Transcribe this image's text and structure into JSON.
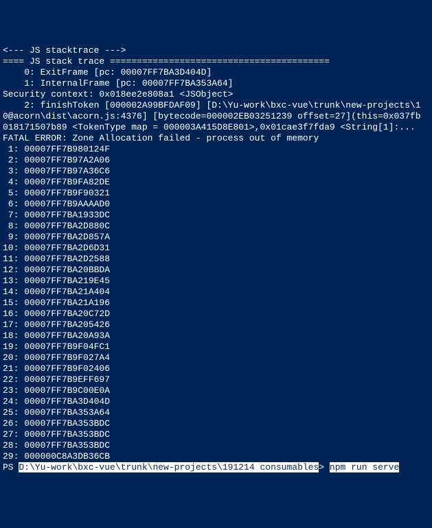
{
  "lines": [
    "<--- JS stacktrace --->",
    "",
    "==== JS stack trace =========================================",
    "",
    "    0: ExitFrame [pc: 00007FF7BA3D404D]",
    "    1: InternalFrame [pc: 00007FF7BA353A64]",
    "Security context: 0x018ee2e808a1 <JSObject>",
    "    2: finishToken [000002A99BFDAF09] [D:\\Yu-work\\bxc-vue\\trunk\\new-projects\\1",
    "0@acorn\\dist\\acorn.js:4376] [bytecode=000002EB03251239 offset=27](this=0x037fb",
    "018171507b89 <TokenType map = 000003A415D8E801>,0x01cae3f7fda9 <String[1]:...",
    "",
    "FATAL ERROR: Zone Allocation failed - process out of memory",
    " 1: 00007FF7B980124F",
    " 2: 00007FF7B97A2A06",
    " 3: 00007FF7B97A36C6",
    " 4: 00007FF7B9FA82DE",
    " 5: 00007FF7B9F90321",
    " 6: 00007FF7B9AAAAD0",
    " 7: 00007FF7BA1933DC",
    " 8: 00007FF7BA2D880C",
    " 9: 00007FF7BA2D857A",
    "10: 00007FF7BA2D6D31",
    "11: 00007FF7BA2D2588",
    "12: 00007FF7BA20BBDA",
    "13: 00007FF7BA219E45",
    "14: 00007FF7BA21A404",
    "15: 00007FF7BA21A196",
    "16: 00007FF7BA20C72D",
    "17: 00007FF7BA205426",
    "18: 00007FF7BA20A93A",
    "19: 00007FF7B9F04FC1",
    "20: 00007FF7B9F027A4",
    "21: 00007FF7B9F02406",
    "22: 00007FF7B9EFF697",
    "23: 00007FF7B9C00E0A",
    "24: 00007FF7BA3D404D",
    "25: 00007FF7BA353A64",
    "26: 00007FF7BA353BDC",
    "27: 00007FF7BA353BDC",
    "28: 00007FF7BA353BDC",
    "29: 000000C8A3DB36CB"
  ],
  "prompt_prefix": "PS ",
  "prompt_path": "D:\\Yu-work\\bxc-vue\\trunk\\new-projects\\191214 consumables",
  "prompt_suffix": "> ",
  "prompt_command": "npm run serve"
}
